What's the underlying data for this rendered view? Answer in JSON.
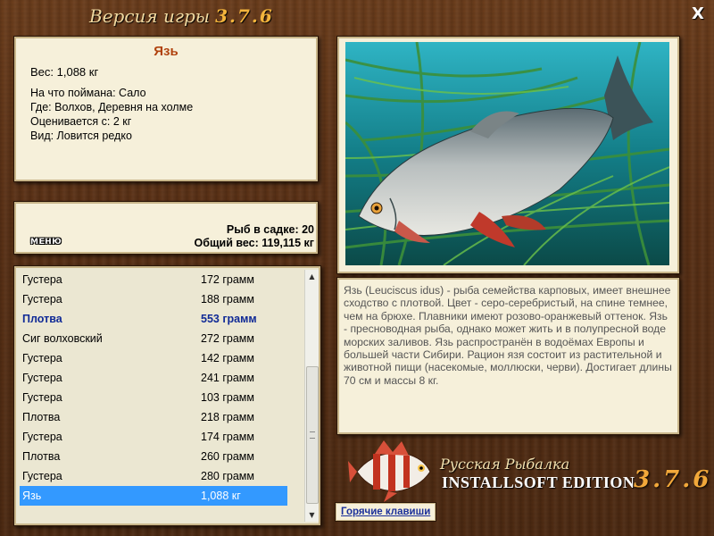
{
  "window": {
    "title_prefix": "Версия игры",
    "title_version": "3.7.6",
    "close_label": "X"
  },
  "fish_info": {
    "name": "Язь",
    "weight": "Вес: 1,088 кг",
    "caught_with": "На что поймана: Сало",
    "location": "Где: Волхов, Деревня на холме",
    "valued_from": "Оценивается с: 2 кг",
    "rarity": "Вид: Ловится редко"
  },
  "summary": {
    "menu_label": "МЕНЮ",
    "fish_in_keepnet": "Рыб в садке: 20",
    "total_weight": "Общий вес: 119,115 кг"
  },
  "catch_list": [
    {
      "name": "Густера",
      "weight": "172 грамм",
      "style": ""
    },
    {
      "name": "Густера",
      "weight": "188 грамм",
      "style": ""
    },
    {
      "name": "Плотва",
      "weight": "553 грамм",
      "style": "hl"
    },
    {
      "name": "Сиг волховский",
      "weight": "272 грамм",
      "style": ""
    },
    {
      "name": "Густера",
      "weight": "142 грамм",
      "style": ""
    },
    {
      "name": "Густера",
      "weight": "241 грамм",
      "style": ""
    },
    {
      "name": "Густера",
      "weight": "103 грамм",
      "style": ""
    },
    {
      "name": "Плотва",
      "weight": "218 грамм",
      "style": ""
    },
    {
      "name": "Густера",
      "weight": "174 грамм",
      "style": ""
    },
    {
      "name": "Плотва",
      "weight": "260 грамм",
      "style": ""
    },
    {
      "name": "Густера",
      "weight": "280 грамм",
      "style": ""
    },
    {
      "name": "Язь",
      "weight": "1,088 кг",
      "style": "sel"
    }
  ],
  "description": "Язь (Leuciscus idus) - рыба семейства карповых, имеет внешнее сходство с плотвой. Цвет - серо-серебристый, на спине темнее, чем на брюхе. Плавники имеют розово-оранжевый оттенок. Язь - пресноводная рыба, однако может жить и в полупресной воде морских заливов. Язь распространён в водоёмах Европы и большей части Сибири. Рацион язя состоит из растительной и животной пищи (насекомые, моллюски, черви). Достигает длины 70 см и массы 8 кг.",
  "logo": {
    "line1": "Русская Рыбалка",
    "line2": "INSTALLSOFT EDITION",
    "version": "3.7.6"
  },
  "hotkeys_label": "Горячие клавиши",
  "colors": {
    "wood": "#5a3116",
    "panel": "#f6f0da",
    "fish_name": "#b0420e",
    "highlight_row": "#102a96",
    "selected_row": "#3399ff",
    "version_orange": "#f2a83a"
  }
}
